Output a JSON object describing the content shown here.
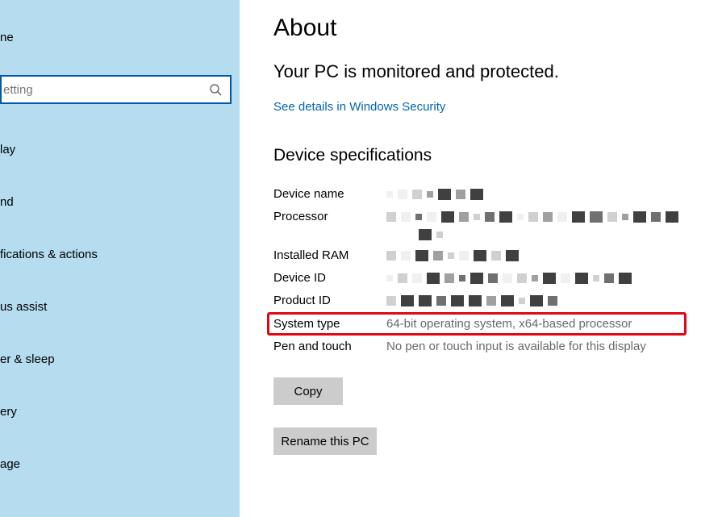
{
  "sidebar": {
    "home": "ne",
    "search": {
      "placeholder": "etting"
    },
    "items": [
      "lay",
      "nd",
      "fications & actions",
      "us assist",
      "er & sleep",
      "ery",
      "age"
    ]
  },
  "main": {
    "title": "About",
    "status": "Your PC is monitored and protected.",
    "security_link": "See details in Windows Security",
    "section_title": "Device specifications",
    "specs": {
      "device_name": {
        "label": "Device name"
      },
      "processor": {
        "label": "Processor"
      },
      "installed_ram": {
        "label": "Installed RAM"
      },
      "device_id": {
        "label": "Device ID"
      },
      "product_id": {
        "label": "Product ID"
      },
      "system_type": {
        "label": "System type",
        "value": "64-bit operating system, x64-based processor"
      },
      "pen_touch": {
        "label": "Pen and touch",
        "value": "No pen or touch input is available for this display"
      }
    },
    "buttons": {
      "copy": "Copy",
      "rename": "Rename this PC"
    }
  }
}
